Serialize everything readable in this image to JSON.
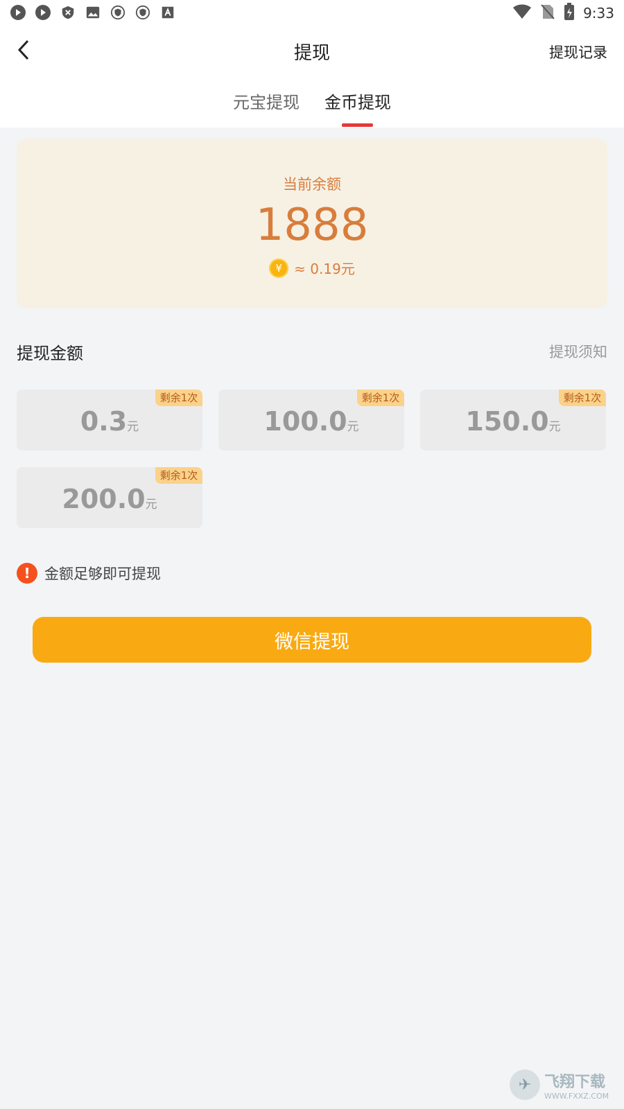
{
  "status_bar": {
    "left_icons": [
      "message-icon",
      "message-icon",
      "shield-x-icon",
      "image-icon",
      "vpn-icon",
      "vpn-icon",
      "text-icon"
    ],
    "time": "9:33"
  },
  "header": {
    "title": "提现",
    "record_label": "提现记录"
  },
  "tabs": [
    {
      "label": "元宝提现",
      "active": false
    },
    {
      "label": "金币提现",
      "active": true
    }
  ],
  "balance": {
    "label": "当前余额",
    "value": "1888",
    "coin_symbol": "¥",
    "approx": "≈ 0.19元"
  },
  "section": {
    "title": "提现金额",
    "notice_label": "提现须知"
  },
  "amounts": [
    {
      "value": "0.3",
      "unit": "元",
      "badge": "剩余1次"
    },
    {
      "value": "100.0",
      "unit": "元",
      "badge": "剩余1次"
    },
    {
      "value": "150.0",
      "unit": "元",
      "badge": "剩余1次"
    },
    {
      "value": "200.0",
      "unit": "元",
      "badge": "剩余1次"
    }
  ],
  "tip": {
    "icon_text": "!",
    "text": "金额足够即可提现"
  },
  "button": {
    "label": "微信提现"
  },
  "watermark": {
    "title": "飞翔下载",
    "url": "WWW.FXXZ.COM"
  },
  "colors": {
    "accent_orange": "#f9aa12",
    "balance_text": "#d87d3c",
    "tab_indicator": "#e53935",
    "tip_icon": "#f4511e"
  }
}
